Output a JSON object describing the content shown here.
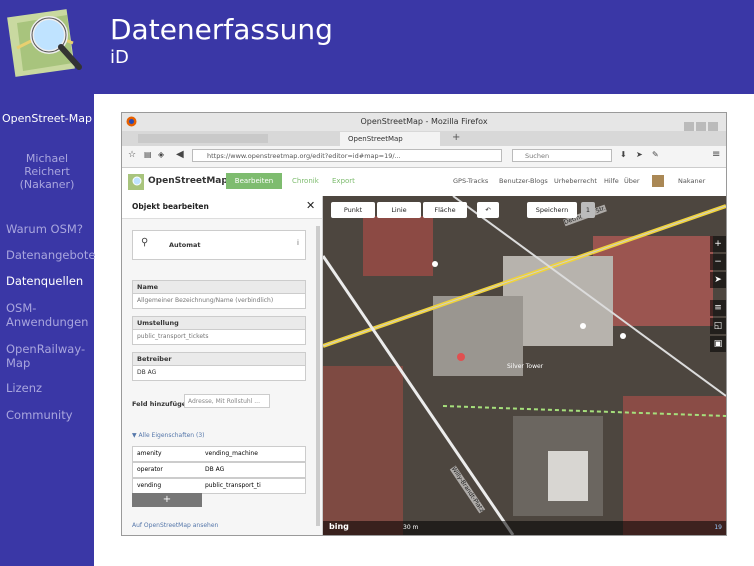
{
  "slide": {
    "title": "Datenerfassung",
    "subtitle": "iD"
  },
  "sidebar": {
    "section": "OpenStreet-Map",
    "author": "Michael Reichert (Nakaner)",
    "items": [
      {
        "label": "Warum OSM?"
      },
      {
        "label": "Datenangebote"
      },
      {
        "label": "Datenquellen"
      },
      {
        "label": "OSM-Anwendungen"
      },
      {
        "label": "OpenRailway-Map"
      },
      {
        "label": "Lizenz"
      },
      {
        "label": "Community"
      }
    ]
  },
  "browser": {
    "window_title": "OpenStreetMap - Mozilla Firefox",
    "tab_label": "OpenStreetMap",
    "url": "https://www.openstreetmap.org/edit?editor=id#map=19/...",
    "search_placeholder": "Suchen"
  },
  "osm": {
    "brand": "OpenStreetMap",
    "edit_button": "Bearbeiten",
    "history": "Chronik",
    "export": "Export",
    "right_links": [
      "GPS-Tracks",
      "Benutzer-Blogs",
      "Urheberrecht",
      "Hilfe",
      "Über"
    ],
    "user": "Nakaner"
  },
  "editor": {
    "header": "Objekt bearbeiten",
    "preset": "Automat",
    "fields": [
      {
        "label": "Name",
        "value": "Allgemeiner Bezeichnung/Name (verbindlich)"
      },
      {
        "label": "Umstellung",
        "value": "public_transport_tickets"
      },
      {
        "label": "Betreiber",
        "value": "DB AG"
      }
    ],
    "add_field_label": "Feld hinzufügen:",
    "add_field_value": "Adresse, Mit Rollstuhl ...",
    "all_tags": "▼ Alle Eigenschaften (3)",
    "tags": [
      {
        "key": "amenity",
        "value": "vending_machine"
      },
      {
        "key": "operator",
        "value": "DB AG"
      },
      {
        "key": "vending",
        "value": "public_transport_ti"
      }
    ],
    "add_tag": "+",
    "footer_link": "Auf OpenStreetMap ansehen"
  },
  "map": {
    "toolbar": [
      "Punkt",
      "Linie",
      "Fläche"
    ],
    "undo": "↶",
    "save": "Speichern",
    "save_count": "1",
    "street_1": "Detmolder Str.",
    "street_2": "Willy-Brandt-Platz",
    "poi": "Silver Tower",
    "scale": "30 m",
    "attribution": "bing",
    "zoom": "19"
  },
  "colors": {
    "theme": "#3a37a6",
    "sidebar_text": "#a9a6de",
    "osm_green": "#7ebc6f"
  }
}
